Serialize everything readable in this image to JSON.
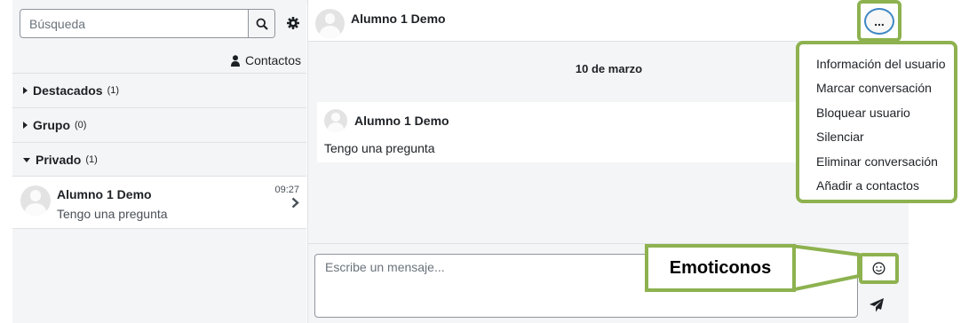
{
  "sidebar": {
    "search_placeholder": "Búsqueda",
    "contacts_label": "Contactos",
    "sections": [
      {
        "name": "Destacados",
        "count": "(1)"
      },
      {
        "name": "Grupo",
        "count": "(0)"
      },
      {
        "name": "Privado",
        "count": "(1)"
      }
    ],
    "conversation": {
      "name": "Alumno 1 Demo",
      "preview": "Tengo una pregunta",
      "time": "09:27"
    }
  },
  "conversation": {
    "header_name": "Alumno 1 Demo",
    "date": "10 de marzo",
    "message": {
      "sender": "Alumno 1 Demo",
      "text": "Tengo una pregunta"
    },
    "input_placeholder": "Escribe un mensaje..."
  },
  "menu": {
    "more_label": "...",
    "items": [
      "Información del usuario",
      "Marcar conversación",
      "Bloquear usuario",
      "Silenciar",
      "Eliminar conversación",
      "Añadir a contactos"
    ]
  },
  "annotation": {
    "callout_label": "Emoticonos"
  },
  "colors": {
    "annotation_green": "#8db24f",
    "focus_blue": "#3f88c5"
  }
}
